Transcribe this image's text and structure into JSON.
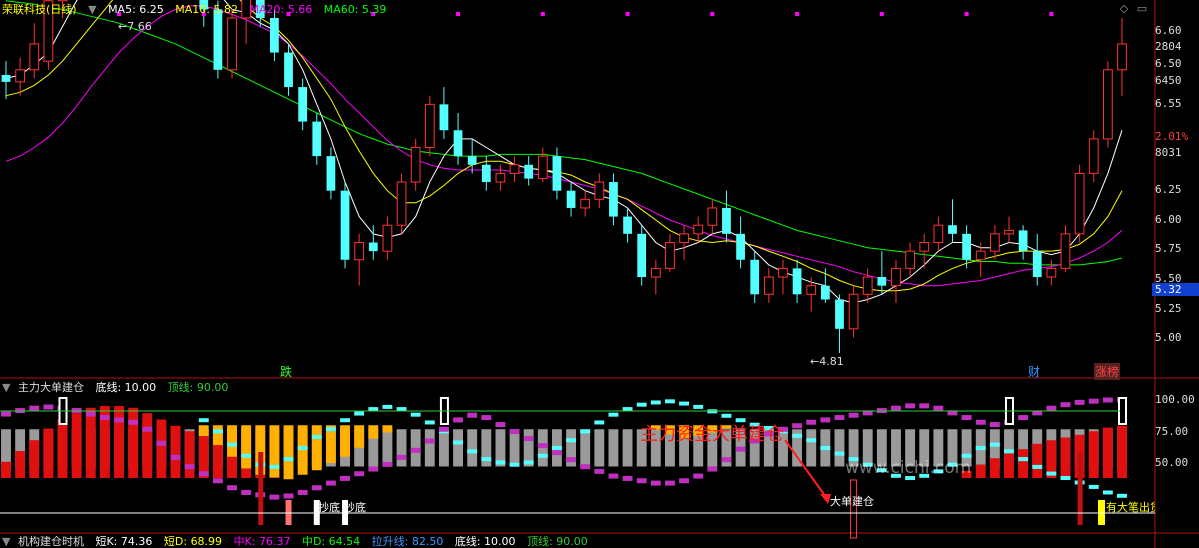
{
  "main_header": {
    "stock_title": "荣联科技",
    "period": "(日线)",
    "ma5_label": "MA5: 6.25",
    "ma10_label": "MA10: 5.82",
    "ma20_label": "MA20: 5.66",
    "ma60_label": "MA60: 5.39"
  },
  "price_axis_labels": [
    "6.60",
    "2804",
    "6.50",
    "6450",
    "6.55",
    "2.01%",
    "8031",
    "6.25",
    "6.00",
    "5.75",
    "5.50",
    "5.32",
    "5.25",
    "5.00"
  ],
  "price_annotations": {
    "high": "7.66",
    "low": "4.81"
  },
  "event_markers": [
    "跌",
    "财",
    "涨榜"
  ],
  "indicator_header": {
    "name": "主力大单建仓",
    "bottom_line": "底线: 10.00",
    "top_line": "顶线: 90.00"
  },
  "indicator_axis_labels": [
    "100.00",
    "75.00",
    "50.00"
  ],
  "indicator_annotations": {
    "watermark": "www.cichi.com",
    "callout": "主力资金大单建仓",
    "big_order_label": "大单建仓",
    "bottom_labels": [
      "抄底",
      "抄底"
    ],
    "sell_label": "有大笔出货"
  },
  "bottom_strip": {
    "name": "机构建仓时机",
    "items": [
      "短K: 74.36",
      "短D: 68.99",
      "中K: 76.37",
      "中D: 64.54",
      "拉升线: 82.50",
      "底线: 10.00",
      "顶线: 90.00"
    ]
  },
  "colors": {
    "up": "#ff3232",
    "down": "#54ffff",
    "ma5": "#ffffff",
    "ma10": "#ffff00",
    "ma20": "#ff00ff",
    "ma60": "#00ff00",
    "accent": "#ff0000",
    "gold": "#ffb000"
  },
  "chart_data": {
    "type": "candlestick",
    "y_range": [
      4.7,
      6.75
    ],
    "candles": [
      [
        6.42,
        6.5,
        6.28,
        6.38
      ],
      [
        6.38,
        6.52,
        6.3,
        6.45
      ],
      [
        6.45,
        6.72,
        6.4,
        6.6
      ],
      [
        6.5,
        6.9,
        6.45,
        6.85
      ],
      [
        6.85,
        7.2,
        6.75,
        7.1
      ],
      [
        7.1,
        7.35,
        7.0,
        7.3
      ],
      [
        7.3,
        7.4,
        6.95,
        7.05
      ],
      [
        7.05,
        7.15,
        6.9,
        6.95
      ],
      [
        6.95,
        7.3,
        6.9,
        7.25
      ],
      [
        7.25,
        7.35,
        6.9,
        7.0
      ],
      [
        7.0,
        7.5,
        6.95,
        7.4
      ],
      [
        7.4,
        7.66,
        7.2,
        7.35
      ],
      [
        7.35,
        7.4,
        7.05,
        7.15
      ],
      [
        7.15,
        7.25,
        6.95,
        7.0
      ],
      [
        7.0,
        7.1,
        6.7,
        6.8
      ],
      [
        6.8,
        6.85,
        6.4,
        6.45
      ],
      [
        6.45,
        6.8,
        6.4,
        6.75
      ],
      [
        6.75,
        6.95,
        6.6,
        6.9
      ],
      [
        6.9,
        7.0,
        6.7,
        6.75
      ],
      [
        6.75,
        6.8,
        6.5,
        6.55
      ],
      [
        6.55,
        6.6,
        6.3,
        6.35
      ],
      [
        6.35,
        6.4,
        6.1,
        6.15
      ],
      [
        6.15,
        6.2,
        5.9,
        5.95
      ],
      [
        5.95,
        6.0,
        5.7,
        5.75
      ],
      [
        5.75,
        5.8,
        5.3,
        5.35
      ],
      [
        5.35,
        5.5,
        5.2,
        5.45
      ],
      [
        5.45,
        5.55,
        5.35,
        5.4
      ],
      [
        5.4,
        5.6,
        5.35,
        5.55
      ],
      [
        5.55,
        5.85,
        5.5,
        5.8
      ],
      [
        5.8,
        6.05,
        5.75,
        6.0
      ],
      [
        6.0,
        6.3,
        5.95,
        6.25
      ],
      [
        6.25,
        6.35,
        6.05,
        6.1
      ],
      [
        6.1,
        6.2,
        5.9,
        5.95
      ],
      [
        5.95,
        6.05,
        5.85,
        5.9
      ],
      [
        5.9,
        5.95,
        5.75,
        5.8
      ],
      [
        5.8,
        5.9,
        5.75,
        5.85
      ],
      [
        5.85,
        5.95,
        5.8,
        5.9
      ],
      [
        5.9,
        5.95,
        5.78,
        5.82
      ],
      [
        5.82,
        6.0,
        5.8,
        5.95
      ],
      [
        5.95,
        6.0,
        5.7,
        5.75
      ],
      [
        5.75,
        5.8,
        5.6,
        5.65
      ],
      [
        5.65,
        5.75,
        5.6,
        5.7
      ],
      [
        5.7,
        5.85,
        5.65,
        5.8
      ],
      [
        5.8,
        5.85,
        5.55,
        5.6
      ],
      [
        5.6,
        5.65,
        5.45,
        5.5
      ],
      [
        5.5,
        5.55,
        5.2,
        5.25
      ],
      [
        5.25,
        5.35,
        5.15,
        5.3
      ],
      [
        5.3,
        5.5,
        5.28,
        5.45
      ],
      [
        5.45,
        5.55,
        5.35,
        5.5
      ],
      [
        5.5,
        5.6,
        5.45,
        5.55
      ],
      [
        5.55,
        5.7,
        5.5,
        5.65
      ],
      [
        5.65,
        5.75,
        5.45,
        5.5
      ],
      [
        5.5,
        5.6,
        5.3,
        5.35
      ],
      [
        5.35,
        5.4,
        5.1,
        5.15
      ],
      [
        5.15,
        5.3,
        5.1,
        5.25
      ],
      [
        5.25,
        5.35,
        5.15,
        5.3
      ],
      [
        5.3,
        5.35,
        5.1,
        5.15
      ],
      [
        5.15,
        5.25,
        5.05,
        5.2
      ],
      [
        5.2,
        5.3,
        5.1,
        5.12
      ],
      [
        5.12,
        5.15,
        4.81,
        4.95
      ],
      [
        4.95,
        5.2,
        4.9,
        5.15
      ],
      [
        5.15,
        5.3,
        5.1,
        5.25
      ],
      [
        5.25,
        5.4,
        5.15,
        5.2
      ],
      [
        5.2,
        5.35,
        5.1,
        5.3
      ],
      [
        5.3,
        5.45,
        5.25,
        5.4
      ],
      [
        5.4,
        5.5,
        5.3,
        5.45
      ],
      [
        5.45,
        5.6,
        5.4,
        5.55
      ],
      [
        5.55,
        5.7,
        5.45,
        5.5
      ],
      [
        5.5,
        5.55,
        5.3,
        5.35
      ],
      [
        5.35,
        5.45,
        5.25,
        5.4
      ],
      [
        5.4,
        5.55,
        5.35,
        5.5
      ],
      [
        5.5,
        5.6,
        5.45,
        5.52
      ],
      [
        5.52,
        5.55,
        5.35,
        5.4
      ],
      [
        5.4,
        5.5,
        5.2,
        5.25
      ],
      [
        5.25,
        5.35,
        5.2,
        5.3
      ],
      [
        5.3,
        5.55,
        5.28,
        5.5
      ],
      [
        5.5,
        5.9,
        5.45,
        5.85
      ],
      [
        5.85,
        6.1,
        5.8,
        6.05
      ],
      [
        6.05,
        6.5,
        6.0,
        6.45
      ],
      [
        6.45,
        6.75,
        6.3,
        6.6
      ]
    ],
    "ma5": [
      6.4,
      6.42,
      6.48,
      6.55,
      6.7,
      6.85,
      6.95,
      7.0,
      7.1,
      7.15,
      7.2,
      7.25,
      7.22,
      7.15,
      7.05,
      6.9,
      6.8,
      6.78,
      6.72,
      6.68,
      6.6,
      6.45,
      6.25,
      6.05,
      5.8,
      5.6,
      5.5,
      5.48,
      5.5,
      5.6,
      5.8,
      5.95,
      6.05,
      6.05,
      6.0,
      5.95,
      5.9,
      5.88,
      5.87,
      5.85,
      5.8,
      5.75,
      5.72,
      5.7,
      5.65,
      5.55,
      5.45,
      5.4,
      5.42,
      5.45,
      5.5,
      5.52,
      5.48,
      5.4,
      5.32,
      5.28,
      5.25,
      5.22,
      5.2,
      5.12,
      5.1,
      5.12,
      5.15,
      5.2,
      5.25,
      5.32,
      5.4,
      5.45,
      5.45,
      5.42,
      5.42,
      5.45,
      5.44,
      5.4,
      5.38,
      5.4,
      5.5,
      5.65,
      5.85,
      6.1
    ],
    "ma10": [
      6.3,
      6.32,
      6.36,
      6.42,
      6.5,
      6.6,
      6.7,
      6.8,
      6.9,
      6.98,
      7.05,
      7.1,
      7.12,
      7.1,
      7.05,
      6.98,
      6.9,
      6.82,
      6.75,
      6.7,
      6.62,
      6.52,
      6.4,
      6.28,
      6.12,
      5.98,
      5.85,
      5.75,
      5.68,
      5.68,
      5.72,
      5.78,
      5.85,
      5.9,
      5.92,
      5.92,
      5.9,
      5.88,
      5.87,
      5.86,
      5.84,
      5.8,
      5.77,
      5.73,
      5.7,
      5.64,
      5.58,
      5.52,
      5.48,
      5.46,
      5.45,
      5.46,
      5.45,
      5.43,
      5.4,
      5.37,
      5.34,
      5.3,
      5.27,
      5.23,
      5.2,
      5.18,
      5.17,
      5.17,
      5.18,
      5.21,
      5.26,
      5.3,
      5.33,
      5.35,
      5.37,
      5.39,
      5.4,
      5.4,
      5.4,
      5.41,
      5.44,
      5.5,
      5.6,
      5.75
    ],
    "ma20": [
      5.92,
      5.95,
      6.0,
      6.06,
      6.14,
      6.24,
      6.35,
      6.45,
      6.55,
      6.63,
      6.7,
      6.76,
      6.8,
      6.82,
      6.82,
      6.8,
      6.77,
      6.74,
      6.7,
      6.66,
      6.6,
      6.53,
      6.45,
      6.37,
      6.28,
      6.2,
      6.12,
      6.04,
      5.98,
      5.93,
      5.9,
      5.88,
      5.87,
      5.87,
      5.87,
      5.87,
      5.86,
      5.85,
      5.84,
      5.82,
      5.8,
      5.78,
      5.76,
      5.73,
      5.7,
      5.66,
      5.62,
      5.58,
      5.55,
      5.52,
      5.49,
      5.47,
      5.45,
      5.43,
      5.41,
      5.39,
      5.37,
      5.35,
      5.33,
      5.31,
      5.28,
      5.26,
      5.24,
      5.22,
      5.21,
      5.2,
      5.2,
      5.21,
      5.22,
      5.23,
      5.25,
      5.27,
      5.29,
      5.3,
      5.31,
      5.33,
      5.36,
      5.4,
      5.45,
      5.52
    ],
    "ma60": [
      6.85,
      6.84,
      6.83,
      6.81,
      6.8,
      6.78,
      6.76,
      6.74,
      6.72,
      6.69,
      6.66,
      6.63,
      6.6,
      6.56,
      6.52,
      6.48,
      6.44,
      6.4,
      6.36,
      6.32,
      6.28,
      6.24,
      6.2,
      6.16,
      6.12,
      6.08,
      6.05,
      6.02,
      6.0,
      5.98,
      5.97,
      5.96,
      5.95,
      5.95,
      5.95,
      5.96,
      5.96,
      5.96,
      5.96,
      5.95,
      5.94,
      5.93,
      5.91,
      5.89,
      5.87,
      5.85,
      5.82,
      5.79,
      5.76,
      5.73,
      5.7,
      5.67,
      5.64,
      5.61,
      5.58,
      5.55,
      5.52,
      5.5,
      5.48,
      5.46,
      5.44,
      5.42,
      5.41,
      5.4,
      5.39,
      5.38,
      5.37,
      5.36,
      5.35,
      5.34,
      5.34,
      5.33,
      5.33,
      5.32,
      5.32,
      5.32,
      5.32,
      5.33,
      5.34,
      5.36
    ],
    "osc_red": [
      18,
      30,
      42,
      55,
      65,
      72,
      78,
      80,
      80,
      78,
      72,
      65,
      58,
      52,
      48,
      45,
      40,
      30,
      20,
      10,
      0,
      0,
      0,
      0,
      0,
      0,
      0,
      0,
      0,
      0,
      0,
      0,
      0,
      0,
      0,
      0,
      0,
      0,
      0,
      0,
      0,
      0,
      0,
      0,
      0,
      0,
      0,
      0,
      0,
      0,
      0,
      0,
      0,
      0,
      0,
      0,
      0,
      0,
      0,
      0,
      0,
      0,
      0,
      0,
      0,
      0,
      0,
      0,
      8,
      15,
      22,
      28,
      32,
      38,
      42,
      45,
      48,
      52,
      56,
      58
    ],
    "osc_gold": [
      0,
      0,
      0,
      0,
      0,
      0,
      0,
      0,
      0,
      0,
      0,
      0,
      0,
      0,
      12,
      22,
      35,
      48,
      55,
      58,
      60,
      55,
      50,
      42,
      35,
      25,
      15,
      8,
      0,
      0,
      0,
      0,
      0,
      0,
      0,
      0,
      0,
      0,
      0,
      0,
      0,
      0,
      0,
      0,
      0,
      0,
      5,
      10,
      14,
      12,
      8,
      4,
      0,
      0,
      0,
      0,
      0,
      0,
      0,
      0,
      0,
      0,
      0,
      0,
      0,
      0,
      0,
      0,
      0,
      0,
      0,
      0,
      0,
      0,
      0,
      0,
      0,
      0,
      0,
      0
    ],
    "osc_cyan": [
      0,
      0,
      0,
      0,
      0,
      0,
      0,
      0,
      0,
      0,
      0,
      0,
      0,
      0,
      20,
      30,
      42,
      52,
      60,
      62,
      55,
      45,
      35,
      28,
      20,
      14,
      10,
      8,
      10,
      15,
      22,
      30,
      40,
      48,
      55,
      58,
      60,
      58,
      52,
      45,
      38,
      30,
      22,
      15,
      10,
      6,
      4,
      3,
      5,
      8,
      12,
      16,
      20,
      24,
      27,
      30,
      34,
      38,
      45,
      50,
      55,
      60,
      65,
      70,
      72,
      70,
      66,
      60,
      52,
      45,
      42,
      48,
      55,
      62,
      68,
      72,
      76,
      80,
      85,
      88
    ],
    "osc_magenta": [
      85,
      88,
      90,
      91,
      90,
      88,
      85,
      82,
      80,
      78,
      72,
      60,
      48,
      40,
      34,
      28,
      22,
      18,
      16,
      14,
      15,
      18,
      22,
      26,
      30,
      34,
      38,
      42,
      48,
      54,
      62,
      72,
      80,
      84,
      82,
      76,
      70,
      64,
      58,
      52,
      46,
      40,
      36,
      32,
      30,
      28,
      26,
      26,
      28,
      32,
      38,
      46,
      55,
      62,
      68,
      72,
      75,
      78,
      80,
      82,
      84,
      86,
      88,
      90,
      92,
      92,
      90,
      86,
      82,
      78,
      76,
      78,
      82,
      86,
      90,
      93,
      95,
      96,
      97,
      97
    ]
  }
}
